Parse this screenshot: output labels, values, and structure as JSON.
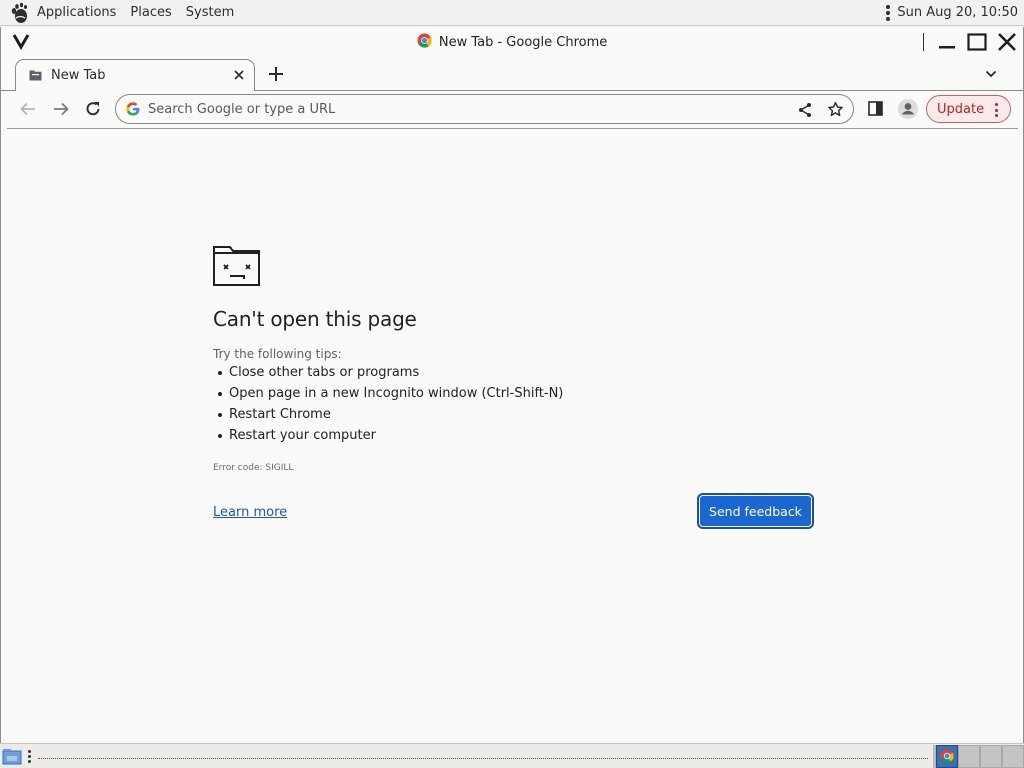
{
  "top_panel": {
    "menus": [
      "Applications",
      "Places",
      "System"
    ],
    "clock": "Sun Aug 20, 10:50"
  },
  "window": {
    "title": "New Tab - Google Chrome"
  },
  "tabs": [
    {
      "title": "New Tab",
      "active": true
    }
  ],
  "toolbar": {
    "omnibox_placeholder": "Search Google or type a URL",
    "omnibox_value": "",
    "update_label": "Update"
  },
  "error_page": {
    "title": "Can't open this page",
    "subtitle": "Try the following tips:",
    "tips": [
      "Close other tabs or programs",
      "Open page in a new Incognito window (Ctrl-Shift-N)",
      "Restart Chrome",
      "Restart your computer"
    ],
    "error_code": "Error code: SIGILL",
    "learn_more": "Learn more",
    "send_feedback": "Send feedback"
  },
  "icons": {
    "panel_logo": "gnome-foot-icon",
    "window_menu": "chevron-down-wm-icon",
    "tab_favicon": "new-tab-page-icon",
    "new_tab": "plus-icon",
    "back": "arrow-left-icon",
    "forward": "arrow-right-icon",
    "reload": "reload-icon",
    "share": "share-icon",
    "bookmark": "star-icon",
    "side_panel": "side-panel-icon",
    "profile": "profile-icon",
    "error_graphic": "sad-folder-icon"
  },
  "colors": {
    "accent": "#1a67d2",
    "link": "#1a56c9",
    "update_text": "#b3261e",
    "update_bg": "#fbeaea",
    "workspace_active": "#3d6fb4"
  }
}
